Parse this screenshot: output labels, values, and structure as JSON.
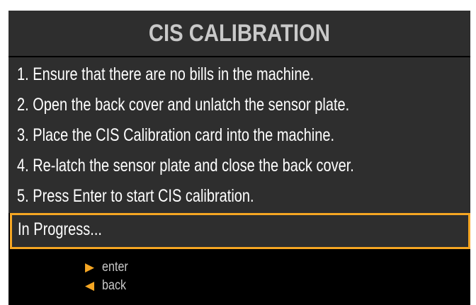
{
  "title": "CIS CALIBRATION",
  "steps": [
    "1. Ensure that there are no bills in the machine.",
    "2. Open the back cover and unlatch the sensor plate.",
    "3. Place the CIS Calibration card into the machine.",
    "4. Re-latch the sensor plate and close the back cover.",
    "5. Press Enter to start CIS calibration."
  ],
  "status": "In Progress...",
  "nav": {
    "enter_icon": "play-right-icon",
    "enter_label": "enter",
    "back_icon": "play-left-icon",
    "back_label": "back"
  },
  "colors": {
    "accent": "#f5a623",
    "panel": "#2e2e2e",
    "background": "#000000",
    "title_text": "#c9c9c9"
  }
}
